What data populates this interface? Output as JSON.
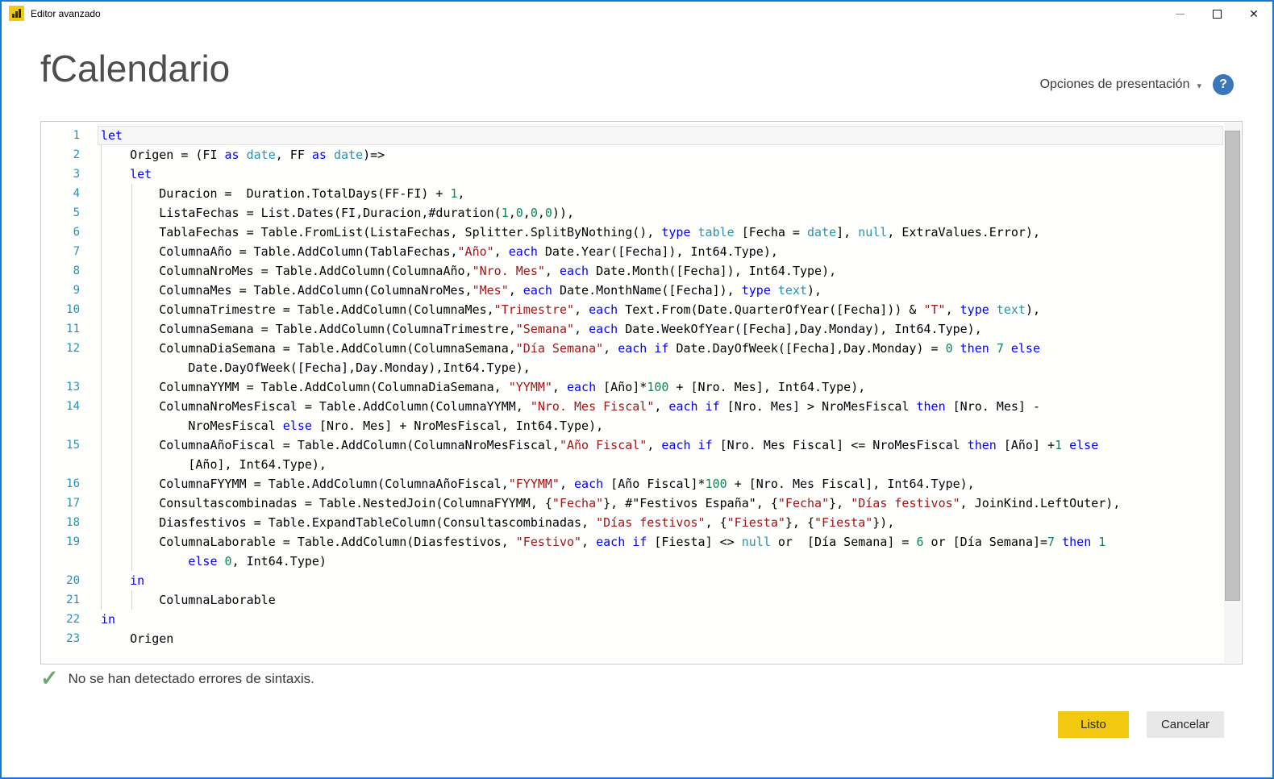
{
  "window": {
    "title": "Editor avanzado"
  },
  "titlebar": {
    "close_icon": "✕"
  },
  "header": {
    "title": "fCalendario",
    "presentation_options_label": "Opciones de presentación",
    "caret_icon": "▾",
    "help_icon": "?"
  },
  "colors": {
    "accent_yellow": "#f2c811",
    "window_border_blue": "#1779d4",
    "keyword": "#0000ff",
    "type": "#2b91af",
    "number": "#09885a",
    "string": "#a31515",
    "line_number": "#2b91af",
    "help_icon_blue": "#3a76ba",
    "check_green": "#6fa56f"
  },
  "editor": {
    "lines": [
      {
        "n": "1",
        "t": [
          [
            "k",
            "let"
          ]
        ]
      },
      {
        "n": "2",
        "t": [
          [
            "p",
            "    Origen = (FI "
          ],
          [
            "k",
            "as"
          ],
          [
            "p",
            " "
          ],
          [
            "t",
            "date"
          ],
          [
            "p",
            ", FF "
          ],
          [
            "k",
            "as"
          ],
          [
            "p",
            " "
          ],
          [
            "t",
            "date"
          ],
          [
            "p",
            ")=>"
          ]
        ]
      },
      {
        "n": "3",
        "t": [
          [
            "p",
            "    "
          ],
          [
            "k",
            "let"
          ]
        ]
      },
      {
        "n": "4",
        "t": [
          [
            "p",
            "        Duracion =  Duration.TotalDays(FF-FI) + "
          ],
          [
            "n",
            "1"
          ],
          [
            "p",
            ","
          ]
        ]
      },
      {
        "n": "5",
        "t": [
          [
            "p",
            "        ListaFechas = List.Dates(FI,Duracion,#duration("
          ],
          [
            "n",
            "1"
          ],
          [
            "p",
            ","
          ],
          [
            "n",
            "0"
          ],
          [
            "p",
            ","
          ],
          [
            "n",
            "0"
          ],
          [
            "p",
            ","
          ],
          [
            "n",
            "0"
          ],
          [
            "p",
            ")),"
          ]
        ]
      },
      {
        "n": "6",
        "t": [
          [
            "p",
            "        TablaFechas = Table.FromList(ListaFechas, Splitter.SplitByNothing(), "
          ],
          [
            "k",
            "type"
          ],
          [
            "p",
            " "
          ],
          [
            "t",
            "table"
          ],
          [
            "p",
            " [Fecha = "
          ],
          [
            "t",
            "date"
          ],
          [
            "p",
            "], "
          ],
          [
            "t",
            "null"
          ],
          [
            "p",
            ", ExtraValues.Error),"
          ]
        ]
      },
      {
        "n": "7",
        "t": [
          [
            "p",
            "        ColumnaAño = Table.AddColumn(TablaFechas,"
          ],
          [
            "s",
            "\"Año\""
          ],
          [
            "p",
            ", "
          ],
          [
            "k",
            "each"
          ],
          [
            "p",
            " Date.Year([Fecha]), Int64.Type),"
          ]
        ]
      },
      {
        "n": "8",
        "t": [
          [
            "p",
            "        ColumnaNroMes = Table.AddColumn(ColumnaAño,"
          ],
          [
            "s",
            "\"Nro. Mes\""
          ],
          [
            "p",
            ", "
          ],
          [
            "k",
            "each"
          ],
          [
            "p",
            " Date.Month([Fecha]), Int64.Type),"
          ]
        ]
      },
      {
        "n": "9",
        "t": [
          [
            "p",
            "        ColumnaMes = Table.AddColumn(ColumnaNroMes,"
          ],
          [
            "s",
            "\"Mes\""
          ],
          [
            "p",
            ", "
          ],
          [
            "k",
            "each"
          ],
          [
            "p",
            " Date.MonthName([Fecha]), "
          ],
          [
            "k",
            "type"
          ],
          [
            "p",
            " "
          ],
          [
            "t",
            "text"
          ],
          [
            "p",
            "),"
          ]
        ]
      },
      {
        "n": "10",
        "t": [
          [
            "p",
            "        ColumnaTrimestre = Table.AddColumn(ColumnaMes,"
          ],
          [
            "s",
            "\"Trimestre\""
          ],
          [
            "p",
            ", "
          ],
          [
            "k",
            "each"
          ],
          [
            "p",
            " Text.From(Date.QuarterOfYear([Fecha])) & "
          ],
          [
            "s",
            "\"T\""
          ],
          [
            "p",
            ", "
          ],
          [
            "k",
            "type"
          ],
          [
            "p",
            " "
          ],
          [
            "t",
            "text"
          ],
          [
            "p",
            "),"
          ]
        ]
      },
      {
        "n": "11",
        "t": [
          [
            "p",
            "        ColumnaSemana = Table.AddColumn(ColumnaTrimestre,"
          ],
          [
            "s",
            "\"Semana\""
          ],
          [
            "p",
            ", "
          ],
          [
            "k",
            "each"
          ],
          [
            "p",
            " Date.WeekOfYear([Fecha],Day.Monday), Int64.Type),"
          ]
        ]
      },
      {
        "n": "12",
        "t": [
          [
            "p",
            "        ColumnaDiaSemana = Table.AddColumn(ColumnaSemana,"
          ],
          [
            "s",
            "\"Día Semana\""
          ],
          [
            "p",
            ", "
          ],
          [
            "k",
            "each"
          ],
          [
            "p",
            " "
          ],
          [
            "k",
            "if"
          ],
          [
            "p",
            " Date.DayOfWeek([Fecha],Day.Monday) = "
          ],
          [
            "n",
            "0"
          ],
          [
            "p",
            " "
          ],
          [
            "k",
            "then"
          ],
          [
            "p",
            " "
          ],
          [
            "n",
            "7"
          ],
          [
            "p",
            " "
          ],
          [
            "k",
            "else"
          ]
        ]
      },
      {
        "n": "",
        "t": [
          [
            "p",
            "            Date.DayOfWeek([Fecha],Day.Monday),Int64.Type),"
          ]
        ]
      },
      {
        "n": "13",
        "t": [
          [
            "p",
            "        ColumnaYYMM = Table.AddColumn(ColumnaDiaSemana, "
          ],
          [
            "s",
            "\"YYMM\""
          ],
          [
            "p",
            ", "
          ],
          [
            "k",
            "each"
          ],
          [
            "p",
            " [Año]*"
          ],
          [
            "n",
            "100"
          ],
          [
            "p",
            " + [Nro. Mes], Int64.Type),"
          ]
        ]
      },
      {
        "n": "14",
        "t": [
          [
            "p",
            "        ColumnaNroMesFiscal = Table.AddColumn(ColumnaYYMM, "
          ],
          [
            "s",
            "\"Nro. Mes Fiscal\""
          ],
          [
            "p",
            ", "
          ],
          [
            "k",
            "each"
          ],
          [
            "p",
            " "
          ],
          [
            "k",
            "if"
          ],
          [
            "p",
            " [Nro. Mes] > NroMesFiscal "
          ],
          [
            "k",
            "then"
          ],
          [
            "p",
            " [Nro. Mes] -"
          ]
        ]
      },
      {
        "n": "",
        "t": [
          [
            "p",
            "            NroMesFiscal "
          ],
          [
            "k",
            "else"
          ],
          [
            "p",
            " [Nro. Mes] + NroMesFiscal, Int64.Type),"
          ]
        ]
      },
      {
        "n": "15",
        "t": [
          [
            "p",
            "        ColumnaAñoFiscal = Table.AddColumn(ColumnaNroMesFiscal,"
          ],
          [
            "s",
            "\"Año Fiscal\""
          ],
          [
            "p",
            ", "
          ],
          [
            "k",
            "each"
          ],
          [
            "p",
            " "
          ],
          [
            "k",
            "if"
          ],
          [
            "p",
            " [Nro. Mes Fiscal] <= NroMesFiscal "
          ],
          [
            "k",
            "then"
          ],
          [
            "p",
            " [Año] +"
          ],
          [
            "n",
            "1"
          ],
          [
            "p",
            " "
          ],
          [
            "k",
            "else"
          ]
        ]
      },
      {
        "n": "",
        "t": [
          [
            "p",
            "            [Año], Int64.Type),"
          ]
        ]
      },
      {
        "n": "16",
        "t": [
          [
            "p",
            "        ColumnaFYYMM = Table.AddColumn(ColumnaAñoFiscal,"
          ],
          [
            "s",
            "\"FYYMM\""
          ],
          [
            "p",
            ", "
          ],
          [
            "k",
            "each"
          ],
          [
            "p",
            " [Año Fiscal]*"
          ],
          [
            "n",
            "100"
          ],
          [
            "p",
            " + [Nro. Mes Fiscal], Int64.Type),"
          ]
        ]
      },
      {
        "n": "17",
        "t": [
          [
            "p",
            "        Consultascombinadas = Table.NestedJoin(ColumnaFYYMM, {"
          ],
          [
            "s",
            "\"Fecha\""
          ],
          [
            "p",
            "}, #\"Festivos España\", {"
          ],
          [
            "s",
            "\"Fecha\""
          ],
          [
            "p",
            "}, "
          ],
          [
            "s",
            "\"Días festivos\""
          ],
          [
            "p",
            ", JoinKind.LeftOuter),"
          ]
        ]
      },
      {
        "n": "18",
        "t": [
          [
            "p",
            "        Diasfestivos = Table.ExpandTableColumn(Consultascombinadas, "
          ],
          [
            "s",
            "\"Días festivos\""
          ],
          [
            "p",
            ", {"
          ],
          [
            "s",
            "\"Fiesta\""
          ],
          [
            "p",
            "}, {"
          ],
          [
            "s",
            "\"Fiesta\""
          ],
          [
            "p",
            "}),"
          ]
        ]
      },
      {
        "n": "19",
        "t": [
          [
            "p",
            "        ColumnaLaborable = Table.AddColumn(Diasfestivos, "
          ],
          [
            "s",
            "\"Festivo\""
          ],
          [
            "p",
            ", "
          ],
          [
            "k",
            "each"
          ],
          [
            "p",
            " "
          ],
          [
            "k",
            "if"
          ],
          [
            "p",
            " [Fiesta] <> "
          ],
          [
            "t",
            "null"
          ],
          [
            "p",
            " or  [Día Semana] = "
          ],
          [
            "n",
            "6"
          ],
          [
            "p",
            " or [Día Semana]="
          ],
          [
            "n",
            "7"
          ],
          [
            "p",
            " "
          ],
          [
            "k",
            "then"
          ],
          [
            "p",
            " "
          ],
          [
            "n",
            "1"
          ]
        ]
      },
      {
        "n": "",
        "t": [
          [
            "p",
            "            "
          ],
          [
            "k",
            "else"
          ],
          [
            "p",
            " "
          ],
          [
            "n",
            "0"
          ],
          [
            "p",
            ", Int64.Type)"
          ]
        ]
      },
      {
        "n": "20",
        "t": [
          [
            "p",
            "    "
          ],
          [
            "k",
            "in"
          ]
        ]
      },
      {
        "n": "21",
        "t": [
          [
            "p",
            "        ColumnaLaborable"
          ]
        ]
      },
      {
        "n": "22",
        "t": [
          [
            "k",
            "in"
          ]
        ]
      },
      {
        "n": "23",
        "t": [
          [
            "p",
            "    Origen"
          ]
        ]
      }
    ]
  },
  "status": {
    "check_icon": "✓",
    "message": "No se han detectado errores de sintaxis."
  },
  "actions": {
    "done": "Listo",
    "cancel": "Cancelar"
  }
}
